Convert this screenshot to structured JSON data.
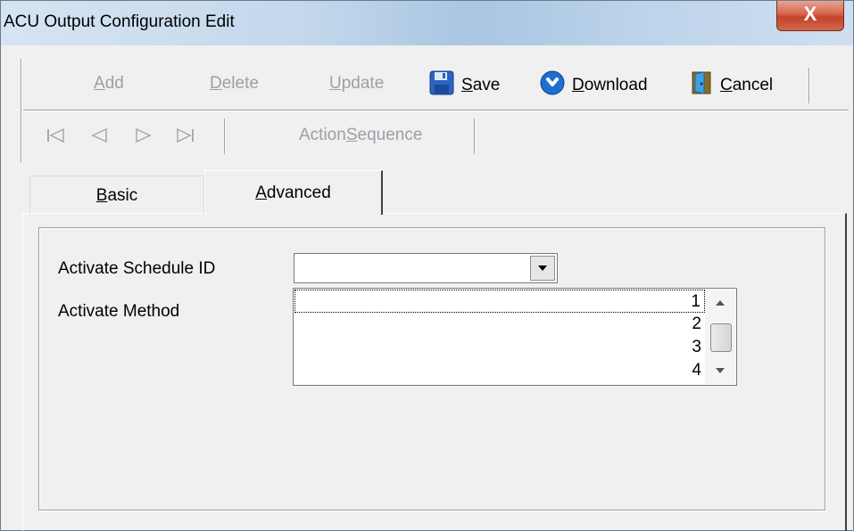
{
  "window": {
    "title": "ACU Output Configuration Edit",
    "close_glyph": "X"
  },
  "toolbar": {
    "add": {
      "label_pre": "",
      "label_key": "A",
      "label_post": "dd"
    },
    "delete": {
      "label_pre": "",
      "label_key": "D",
      "label_post": "elete"
    },
    "update": {
      "label_pre": "",
      "label_key": "U",
      "label_post": "pdate"
    },
    "save": {
      "label_pre": "",
      "label_key": "S",
      "label_post": "ave",
      "icon": "floppy-disk-icon"
    },
    "download": {
      "label_pre": "",
      "label_key": "D",
      "label_post": "ownload",
      "icon": "download-arrow-icon"
    },
    "cancel": {
      "label_pre": "",
      "label_key": "C",
      "label_post": "ancel",
      "icon": "door-exit-icon"
    }
  },
  "nav_toolbar": {
    "action_sequence": {
      "label_pre": "Action ",
      "label_key": "S",
      "label_post": "equence"
    },
    "icons": [
      "first-record-icon",
      "previous-record-icon",
      "next-record-icon",
      "last-record-icon"
    ]
  },
  "tabs": {
    "basic": {
      "label_pre": "",
      "label_key": "B",
      "label_post": "asic"
    },
    "advanced": {
      "label_pre": "",
      "label_key": "A",
      "label_post": "dvanced"
    }
  },
  "form": {
    "activate_schedule_label": "Activate Schedule ID",
    "activate_schedule_value": "",
    "activate_method_label": "Activate Method",
    "method_options": [
      "1",
      "2",
      "3",
      "4"
    ]
  },
  "colors": {
    "disabled_text": "#9aa0a6",
    "save_icon": "#2b64c0",
    "download_icon": "#1f6fd0",
    "cancel_icon": "#2f7fbf"
  }
}
